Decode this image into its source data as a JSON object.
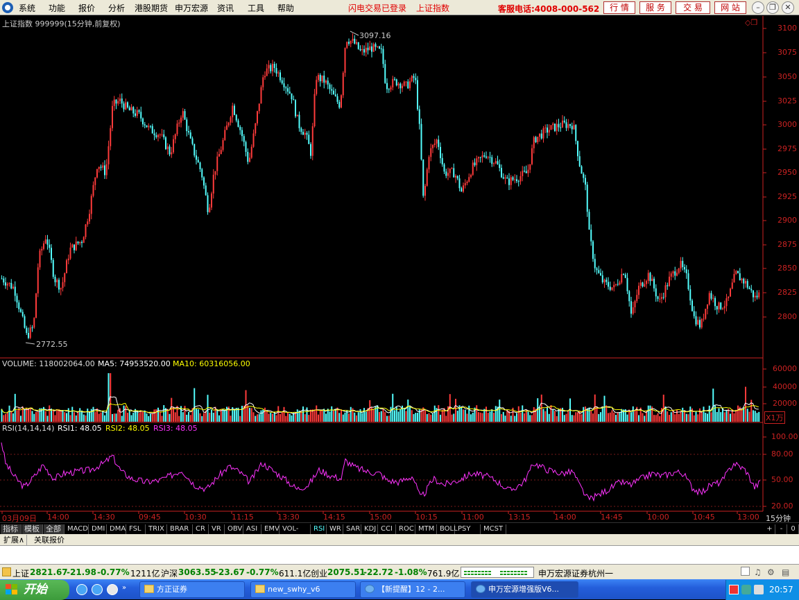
{
  "menubar": {
    "items": [
      "系统",
      "功能",
      "报价",
      "分析",
      "港股期货",
      "申万宏源",
      "资讯",
      "工具",
      "帮助"
    ],
    "status_login": "闪电交易已登录",
    "status_index": "上证指数",
    "hotline": "客服电话:4008-000-562",
    "tabs": [
      "行 情",
      "服 务",
      "交 易",
      "网 站"
    ]
  },
  "chart": {
    "title": "上证指数 999999(15分钟,前复权)",
    "high_label": "3097.16",
    "low_label": "2772.55",
    "price_ticks": [
      "3100",
      "3075",
      "3050",
      "3025",
      "3000",
      "2975",
      "2950",
      "2925",
      "2900",
      "2875",
      "2850",
      "2825",
      "2800"
    ],
    "volume": {
      "label": "VOLUME: 118002064.00",
      "ma5": "MA5: 74953520.00",
      "ma10": "MA10: 60316056.00",
      "ticks": [
        "60000",
        "40000",
        "20000"
      ],
      "unit": "X1万"
    },
    "rsi": {
      "label": "RSI(14,14,14)",
      "rsi1": "RSI1: 48.05",
      "rsi2": "RSI2: 48.05",
      "rsi3": "RSI3: 48.05",
      "ticks": [
        "100.00",
        "80.00",
        "50.00",
        "20.00"
      ]
    },
    "time_ticks": [
      "03月09日",
      "14:00",
      "14:30",
      "09:45",
      "10:30",
      "11:15",
      "13:30",
      "14:15",
      "15:00",
      "10:15",
      "11:00",
      "13:15",
      "14:00",
      "14:45",
      "10:00",
      "10:45",
      "13:00"
    ],
    "period": "15分钟",
    "colors": {
      "up": "#ff3b3b",
      "down": "#54ffff",
      "ma5": "#ffffff",
      "ma10": "#ffff00",
      "rsi": "#ff33ff",
      "axis": "#cc2222"
    }
  },
  "indicator_tabs": [
    "指标",
    "模板",
    "全部",
    "MACD",
    "DMI",
    "DMA",
    "FSL",
    "TRIX",
    "BRAR",
    "CR",
    "VR",
    "OBV",
    "ASI",
    "EMV",
    "VOL-TDX",
    "RSI",
    "WR",
    "SAR",
    "KDJ",
    "CCI",
    "ROC",
    "MTM",
    "BOLL",
    "PSY",
    "MCST"
  ],
  "indicator_active": "RSI",
  "zoom_controls": [
    "+",
    "-",
    "0"
  ],
  "ext_tabs": [
    "扩展∧",
    "关联报价"
  ],
  "ticker": {
    "sh_name": "上证",
    "sh_val": "2821.67",
    "sh_chg": "-21.98",
    "sh_pct": "-0.77%",
    "sh_amt": "1211亿",
    "hs_name": "沪深",
    "hs_val": "3063.55",
    "hs_chg": "-23.67",
    "hs_pct": "-0.77%",
    "hs_amt": "611.1亿",
    "cy_name": "创业",
    "cy_val": "2075.51",
    "cy_chg": "-22.72",
    "cy_pct": "-1.08%",
    "cy_amt": "761.9亿",
    "broker": "申万宏源证券杭州一"
  },
  "taskbar": {
    "start": "开始",
    "tasks": [
      "方正证券",
      "new_swhy_v6",
      "【新提醒】12 - 2...",
      "申万宏源增强版V6..."
    ],
    "clock": "20:57"
  }
}
